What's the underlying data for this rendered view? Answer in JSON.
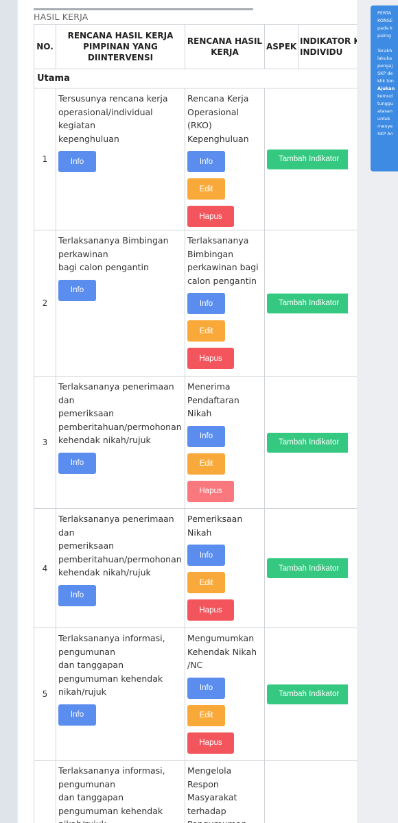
{
  "section_title": "HASIL KERJA",
  "headers": {
    "no": "NO.",
    "rhk_pimpinan": "RENCANA HASIL KERJA PIMPINAN YANG DIINTERVENSI",
    "rhk": "RENCANA HASIL KERJA",
    "aspek": "ASPEK",
    "indikator": "INDIKATOR KINERJA INDIVIDU"
  },
  "group_label": "Utama",
  "buttons": {
    "info": "Info",
    "edit": "Edit",
    "hapus": "Hapus",
    "tambah_indikator": "Tambah Indikator"
  },
  "rows": [
    {
      "no": "1",
      "rhk_pimpinan": "Tersusunya rencana kerja operasional/individual kegiatan\nkepenghuluan",
      "rhk": "Rencana Kerja Operasional (RKO) Kepenghuluan"
    },
    {
      "no": "2",
      "rhk_pimpinan": "Terlaksananya Bimbingan perkawinan\nbagi calon pengantin",
      "rhk": "Terlaksananya Bimbingan perkawinan bagi calon pengantin"
    },
    {
      "no": "3",
      "rhk_pimpinan": "Terlaksananya penerimaan dan\npemeriksaan pemberitahuan/permohonan kehendak nikah/rujuk",
      "rhk": "Menerima Pendaftaran Nikah"
    },
    {
      "no": "4",
      "rhk_pimpinan": "Terlaksananya penerimaan dan\npemeriksaan pemberitahuan/permohonan kehendak nikah/rujuk",
      "rhk": "Pemeriksaan Nikah"
    },
    {
      "no": "5",
      "rhk_pimpinan": "Terlaksananya informasi, pengumunan\ndan tanggapan pengumuman kehendak\nnikah/rujuk",
      "rhk": "Mengumumkan Kehendak Nikah /NC"
    },
    {
      "no": "",
      "rhk_pimpinan": "Terlaksananya informasi, pengumunan\ndan tanggapan pengumuman kehendak\nnikah/rujuk",
      "rhk": "Mengelola Respon Masyarakat terhadap Pengumuman"
    }
  ],
  "notice_panel": {
    "line1": "PERTA",
    "line2": "KONSE",
    "line3": "pada k",
    "line4": "paling",
    "line5": "Terakh",
    "line6": "lakuka",
    "line7": "pengaj",
    "line8": "SKP de",
    "line9": "klik ton",
    "line10": "Ajukan",
    "line11": "kemud",
    "line12": "tunggu",
    "line13": "atasan",
    "line14": "untuk",
    "line15": "menye",
    "line16": "SKP An"
  },
  "colors": {
    "info": "#5a8dee",
    "edit": "#f9a93a",
    "hapus": "#f2555c",
    "tambah": "#35c881",
    "notice": "#3d8be3"
  }
}
